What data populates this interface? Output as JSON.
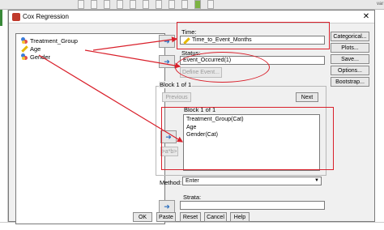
{
  "background": {
    "right_column_label": "var"
  },
  "dialog": {
    "title": "Cox Regression",
    "close_glyph": "✕",
    "variables": [
      {
        "label": "Treatment_Group"
      },
      {
        "label": "Age"
      },
      {
        "label": "Gender"
      }
    ],
    "time": {
      "label": "Time:",
      "value": "Time_to_Event_Months"
    },
    "status": {
      "label": "Status:",
      "value": "Event_Occurred(1)",
      "define_event_label": "Define Event..."
    },
    "block": {
      "label": "Block 1 of 1",
      "previous_label": "Previous",
      "next_label": "Next",
      "covariates_label": "Block 1 of 1",
      "covariates": [
        "Treatment_Group(Cat)",
        "Age",
        "Gender(Cat)"
      ],
      "interaction_label": ">a*b>"
    },
    "method": {
      "label": "Method:",
      "value": "Enter"
    },
    "strata": {
      "label": "Strata:",
      "value": ""
    },
    "side_buttons": [
      "Categorical...",
      "Plots...",
      "Save...",
      "Options...",
      "Bootstrap..."
    ],
    "bottom_buttons": [
      "OK",
      "Paste",
      "Reset",
      "Cancel",
      "Help"
    ]
  },
  "colors": {
    "annotation_red": "#d91f2a",
    "arrow_blue": "#2d6fbf"
  }
}
